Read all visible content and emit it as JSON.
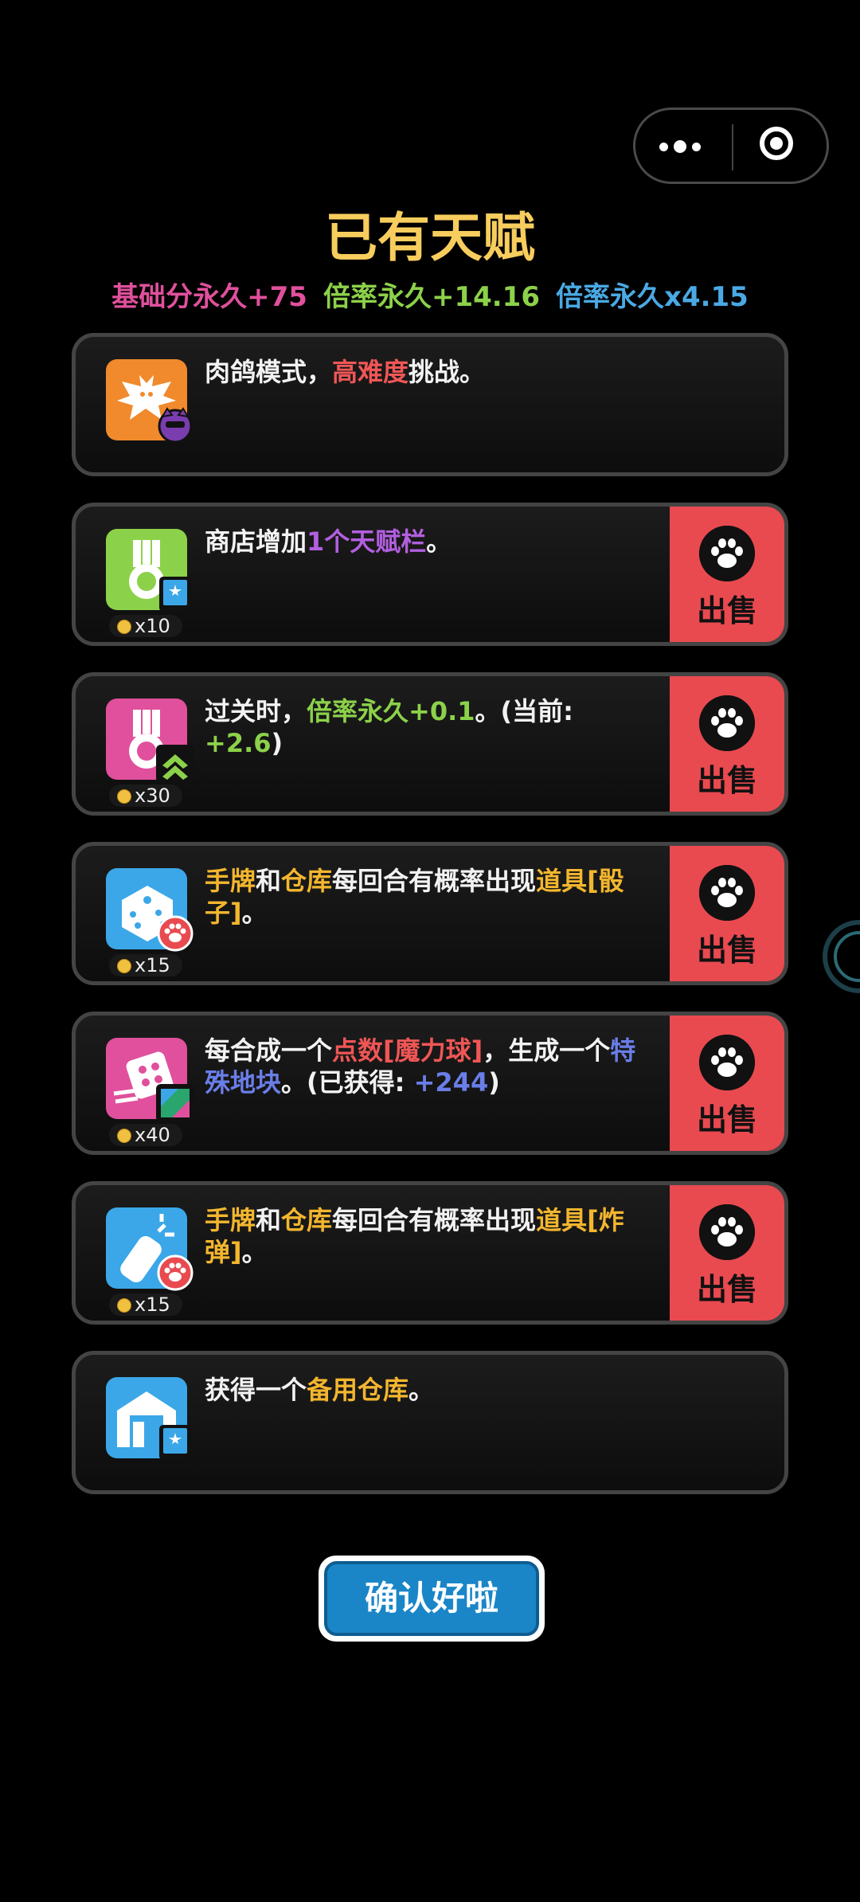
{
  "capsule": {
    "more_icon": "more-dots-icon",
    "close_icon": "target-close-icon"
  },
  "page": {
    "title": "已有天赋"
  },
  "stats": [
    {
      "text": "基础分永久+75",
      "color": "#e0509c"
    },
    {
      "text": "倍率永久+14.16",
      "color": "#8cd14a"
    },
    {
      "text": "倍率永久x4.15",
      "color": "#4aa9e4"
    }
  ],
  "sell_label": "出售",
  "talents": [
    {
      "icon": "bat-icon",
      "badge": "cat-face-icon",
      "parts": [
        {
          "text": "肉鸽模式，",
          "color": "#f2f2f2"
        },
        {
          "text": "高难度",
          "color": "#f05656"
        },
        {
          "text": "挑战。",
          "color": "#f2f2f2"
        }
      ],
      "price": "",
      "sellable": false
    },
    {
      "icon": "medal-green-icon",
      "badge": "book-star-icon",
      "parts": [
        {
          "text": "商店增加",
          "color": "#f2f2f2"
        },
        {
          "text": "1个天赋栏",
          "color": "#b25fe0"
        },
        {
          "text": "。",
          "color": "#f2f2f2"
        }
      ],
      "price": "x10",
      "sellable": true
    },
    {
      "icon": "medal-pink-icon",
      "badge": "double-chevron-up-icon",
      "parts": [
        {
          "text": "过关时，",
          "color": "#f2f2f2"
        },
        {
          "text": "倍率永久+0.1",
          "color": "#8cd14a"
        },
        {
          "text": "。(当前: ",
          "color": "#f2f2f2"
        },
        {
          "text": "+2.6",
          "color": "#8cd14a"
        },
        {
          "text": ")",
          "color": "#f2f2f2"
        }
      ],
      "price": "x30",
      "sellable": true
    },
    {
      "icon": "dice-icon",
      "badge": "paw-circle-icon",
      "parts": [
        {
          "text": "手牌",
          "color": "#f3b62e"
        },
        {
          "text": "和",
          "color": "#f2f2f2"
        },
        {
          "text": "仓库",
          "color": "#f3b62e"
        },
        {
          "text": "每回合有概率出现",
          "color": "#f2f2f2"
        },
        {
          "text": "道具[骰子]",
          "color": "#f3b62e"
        },
        {
          "text": "。",
          "color": "#f2f2f2"
        }
      ],
      "price": "x15",
      "sellable": true
    },
    {
      "icon": "pink-dice-icon",
      "badge": "map-tile-icon",
      "parts": [
        {
          "text": "每合成一个",
          "color": "#f2f2f2"
        },
        {
          "text": "点数[魔力球]",
          "color": "#f05656"
        },
        {
          "text": "，生成一个",
          "color": "#f2f2f2"
        },
        {
          "text": "特殊地块",
          "color": "#6a7ee8"
        },
        {
          "text": "。(已获得: ",
          "color": "#f2f2f2"
        },
        {
          "text": "+244",
          "color": "#6a7ee8"
        },
        {
          "text": ")",
          "color": "#f2f2f2"
        }
      ],
      "price": "x40",
      "sellable": true
    },
    {
      "icon": "bomb-icon",
      "badge": "paw-circle-icon",
      "parts": [
        {
          "text": "手牌",
          "color": "#f3b62e"
        },
        {
          "text": "和",
          "color": "#f2f2f2"
        },
        {
          "text": "仓库",
          "color": "#f3b62e"
        },
        {
          "text": "每回合有概率出现",
          "color": "#f2f2f2"
        },
        {
          "text": "道具[炸弹]",
          "color": "#f3b62e"
        },
        {
          "text": "。",
          "color": "#f2f2f2"
        }
      ],
      "price": "x15",
      "sellable": true
    },
    {
      "icon": "warehouse-icon",
      "badge": "book-star-icon",
      "parts": [
        {
          "text": "获得一个",
          "color": "#f2f2f2"
        },
        {
          "text": "备用仓库",
          "color": "#f3b62e"
        },
        {
          "text": "。",
          "color": "#f2f2f2"
        }
      ],
      "price": "",
      "sellable": false
    }
  ],
  "confirm": {
    "label": "确认好啦"
  }
}
